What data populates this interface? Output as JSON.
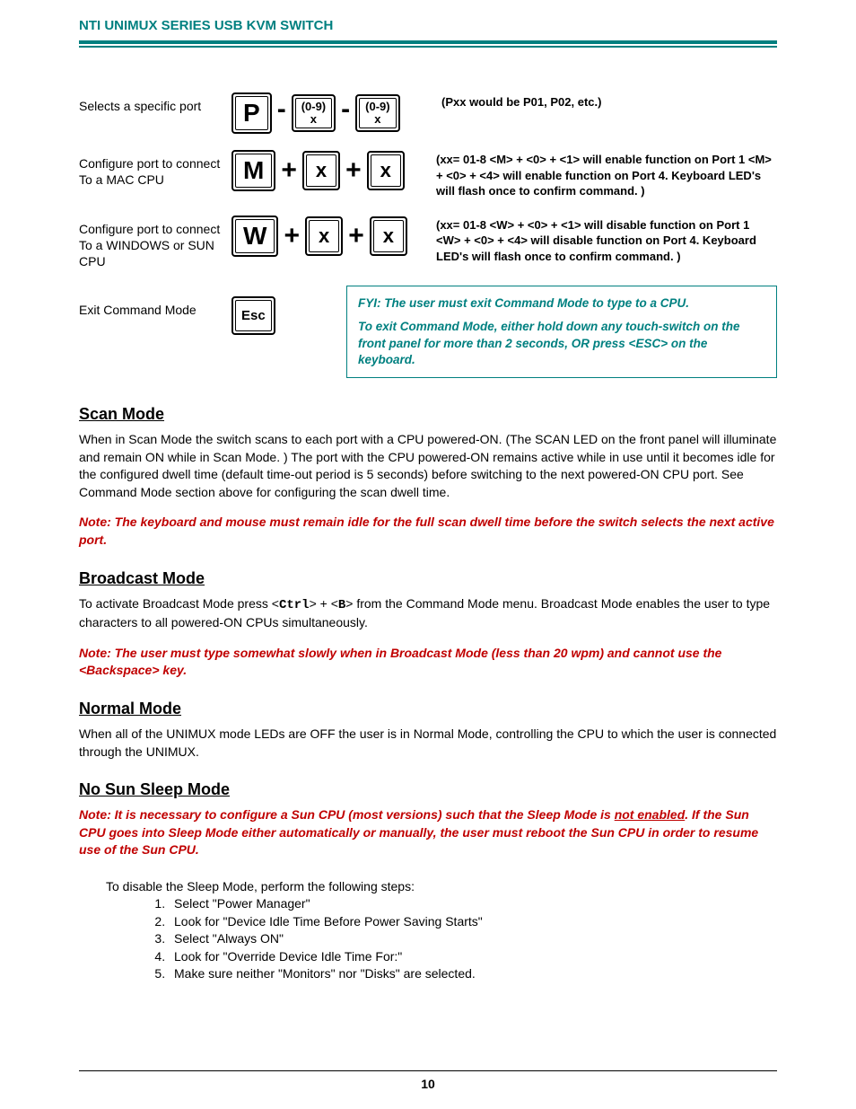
{
  "header": {
    "title": "NTI UNIMUX SERIES USB KVM SWITCH"
  },
  "commands": {
    "selectPort": {
      "label": "Selects a specific port",
      "keyP": "P",
      "keyDigitTop": "(0-9)",
      "keyDigitBot": "x",
      "desc": "(Pxx would be P01, P02, etc.)"
    },
    "mac": {
      "label": "Configure port to connect To a MAC CPU",
      "keyM": "M",
      "keyX": "x",
      "desc": "(xx= 01-8  <M> + <0> + <1> will enable function on Port 1 <M> + <0> + <4> will enable function on Port 4.   Keyboard LED's will flash once to confirm command. )"
    },
    "win": {
      "label": "Configure port to connect To a WINDOWS or SUN CPU",
      "keyW": "W",
      "keyX": "x",
      "desc": "(xx= 01-8  <W> + <0> + <1> will disable function on Port 1 <W> + <0> + <4> will disable function on Port 4.   Keyboard LED's will flash once to confirm command. )"
    },
    "exit": {
      "label": "Exit Command Mode",
      "keyEsc": "Esc"
    },
    "fyi": {
      "line1": "FYI:  The user must exit Command Mode to type to a CPU.",
      "line2": "To exit Command Mode, either hold down any touch-switch on the front panel for more than 2 seconds, OR  press <ESC> on the keyboard."
    }
  },
  "scan": {
    "heading": "Scan Mode",
    "body": "When in Scan Mode the switch scans to each port with a CPU powered-ON. (The SCAN LED on the front panel will illuminate and remain ON while in Scan Mode. ) The port with the CPU powered-ON remains active while in use until it becomes idle for the configured dwell time (default time-out period is 5 seconds) before switching to the next powered-ON CPU port. See Command Mode section above for configuring the scan dwell time.",
    "note": "Note: The keyboard and mouse must remain idle for the full scan dwell time before the switch selects the next active port."
  },
  "broadcast": {
    "heading": "Broadcast Mode",
    "body_pre": "To activate Broadcast Mode press <",
    "ctrl": "Ctrl",
    "body_mid": "> + <",
    "b": "B",
    "body_post": "> from the Command Mode menu.  Broadcast Mode enables the user to type characters to all powered-ON CPUs simultaneously.",
    "note": "Note:  The user must type somewhat slowly when in Broadcast Mode (less than 20 wpm) and cannot use the <Backspace> key."
  },
  "normal": {
    "heading": "Normal Mode",
    "body": "When all of the UNIMUX mode LEDs are OFF the user is in Normal Mode, controlling the CPU to which the user is connected through the UNIMUX."
  },
  "sleep": {
    "heading": "No Sun Sleep Mode",
    "note_pre": "Note:  It is necessary to configure a Sun CPU (most versions) such that the Sleep Mode is ",
    "not_enabled": "not enabled",
    "note_post": ".  If the Sun CPU goes into Sleep Mode either automatically or manually, the user must reboot the Sun CPU in order to resume use of the Sun CPU.",
    "intro": "To disable the Sleep Mode, perform the following steps:",
    "steps": [
      "Select \"Power Manager\"",
      "Look for \"Device Idle Time Before Power Saving Starts\"",
      "Select \"Always ON\"",
      "Look for \"Override Device Idle Time For:\"",
      "Make sure neither \"Monitors\" nor \"Disks\" are selected."
    ]
  },
  "pageNumber": "10"
}
